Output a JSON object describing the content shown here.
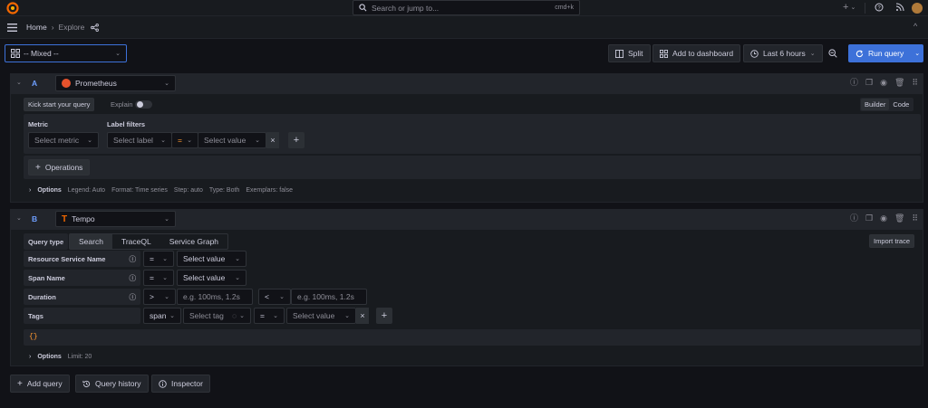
{
  "topbar": {
    "search_placeholder": "Search or jump to...",
    "search_shortcut": "cmd+k",
    "plus_menu_label": "+",
    "breadcrumb": {
      "home": "Home",
      "current": "Explore"
    }
  },
  "toolbar": {
    "datasource_selected": "-- Mixed --",
    "split_label": "Split",
    "add_dashboard_label": "Add to dashboard",
    "time_range_label": "Last 6 hours",
    "run_query_label": "Run query"
  },
  "queries": [
    {
      "ref": "A",
      "datasource": "Prometheus",
      "kick_start_label": "Kick start your query",
      "explain_label": "Explain",
      "builder_label": "Builder",
      "code_label": "Code",
      "metric_header": "Metric",
      "metric_placeholder": "Select metric",
      "label_filters_header": "Label filters",
      "label_placeholder": "Select label",
      "operator": "=",
      "value_placeholder": "Select value",
      "operations_label": "Operations",
      "options_label": "Options",
      "options_summary": [
        "Legend: Auto",
        "Format: Time series",
        "Step: auto",
        "Type: Both",
        "Exemplars: false"
      ]
    },
    {
      "ref": "B",
      "datasource": "Tempo",
      "query_type_label": "Query type",
      "query_types": [
        "Search",
        "TraceQL",
        "Service Graph"
      ],
      "import_trace_label": "Import trace",
      "rows": [
        {
          "label": "Resource Service Name",
          "operator": "=",
          "value": "Select value"
        },
        {
          "label": "Span Name",
          "operator": "=",
          "value": "Select value"
        },
        {
          "label": "Duration",
          "op1": ">",
          "ph1": "e.g. 100ms, 1.2s",
          "op2": "<",
          "ph2": "e.g. 100ms, 1.2s"
        },
        {
          "label": "Tags",
          "scope": "span",
          "tag_placeholder": "Select tag",
          "operator": "=",
          "value": "Select value"
        }
      ],
      "query_preview": "{}",
      "options_label": "Options",
      "options_summary": "Limit: 20"
    }
  ],
  "footer": {
    "add_query_label": "Add query",
    "query_history_label": "Query history",
    "inspector_label": "Inspector"
  },
  "colors": {
    "accent": "#3d71d9",
    "background": "#111217",
    "panel": "#181b1f",
    "operator": "#ff9830"
  }
}
